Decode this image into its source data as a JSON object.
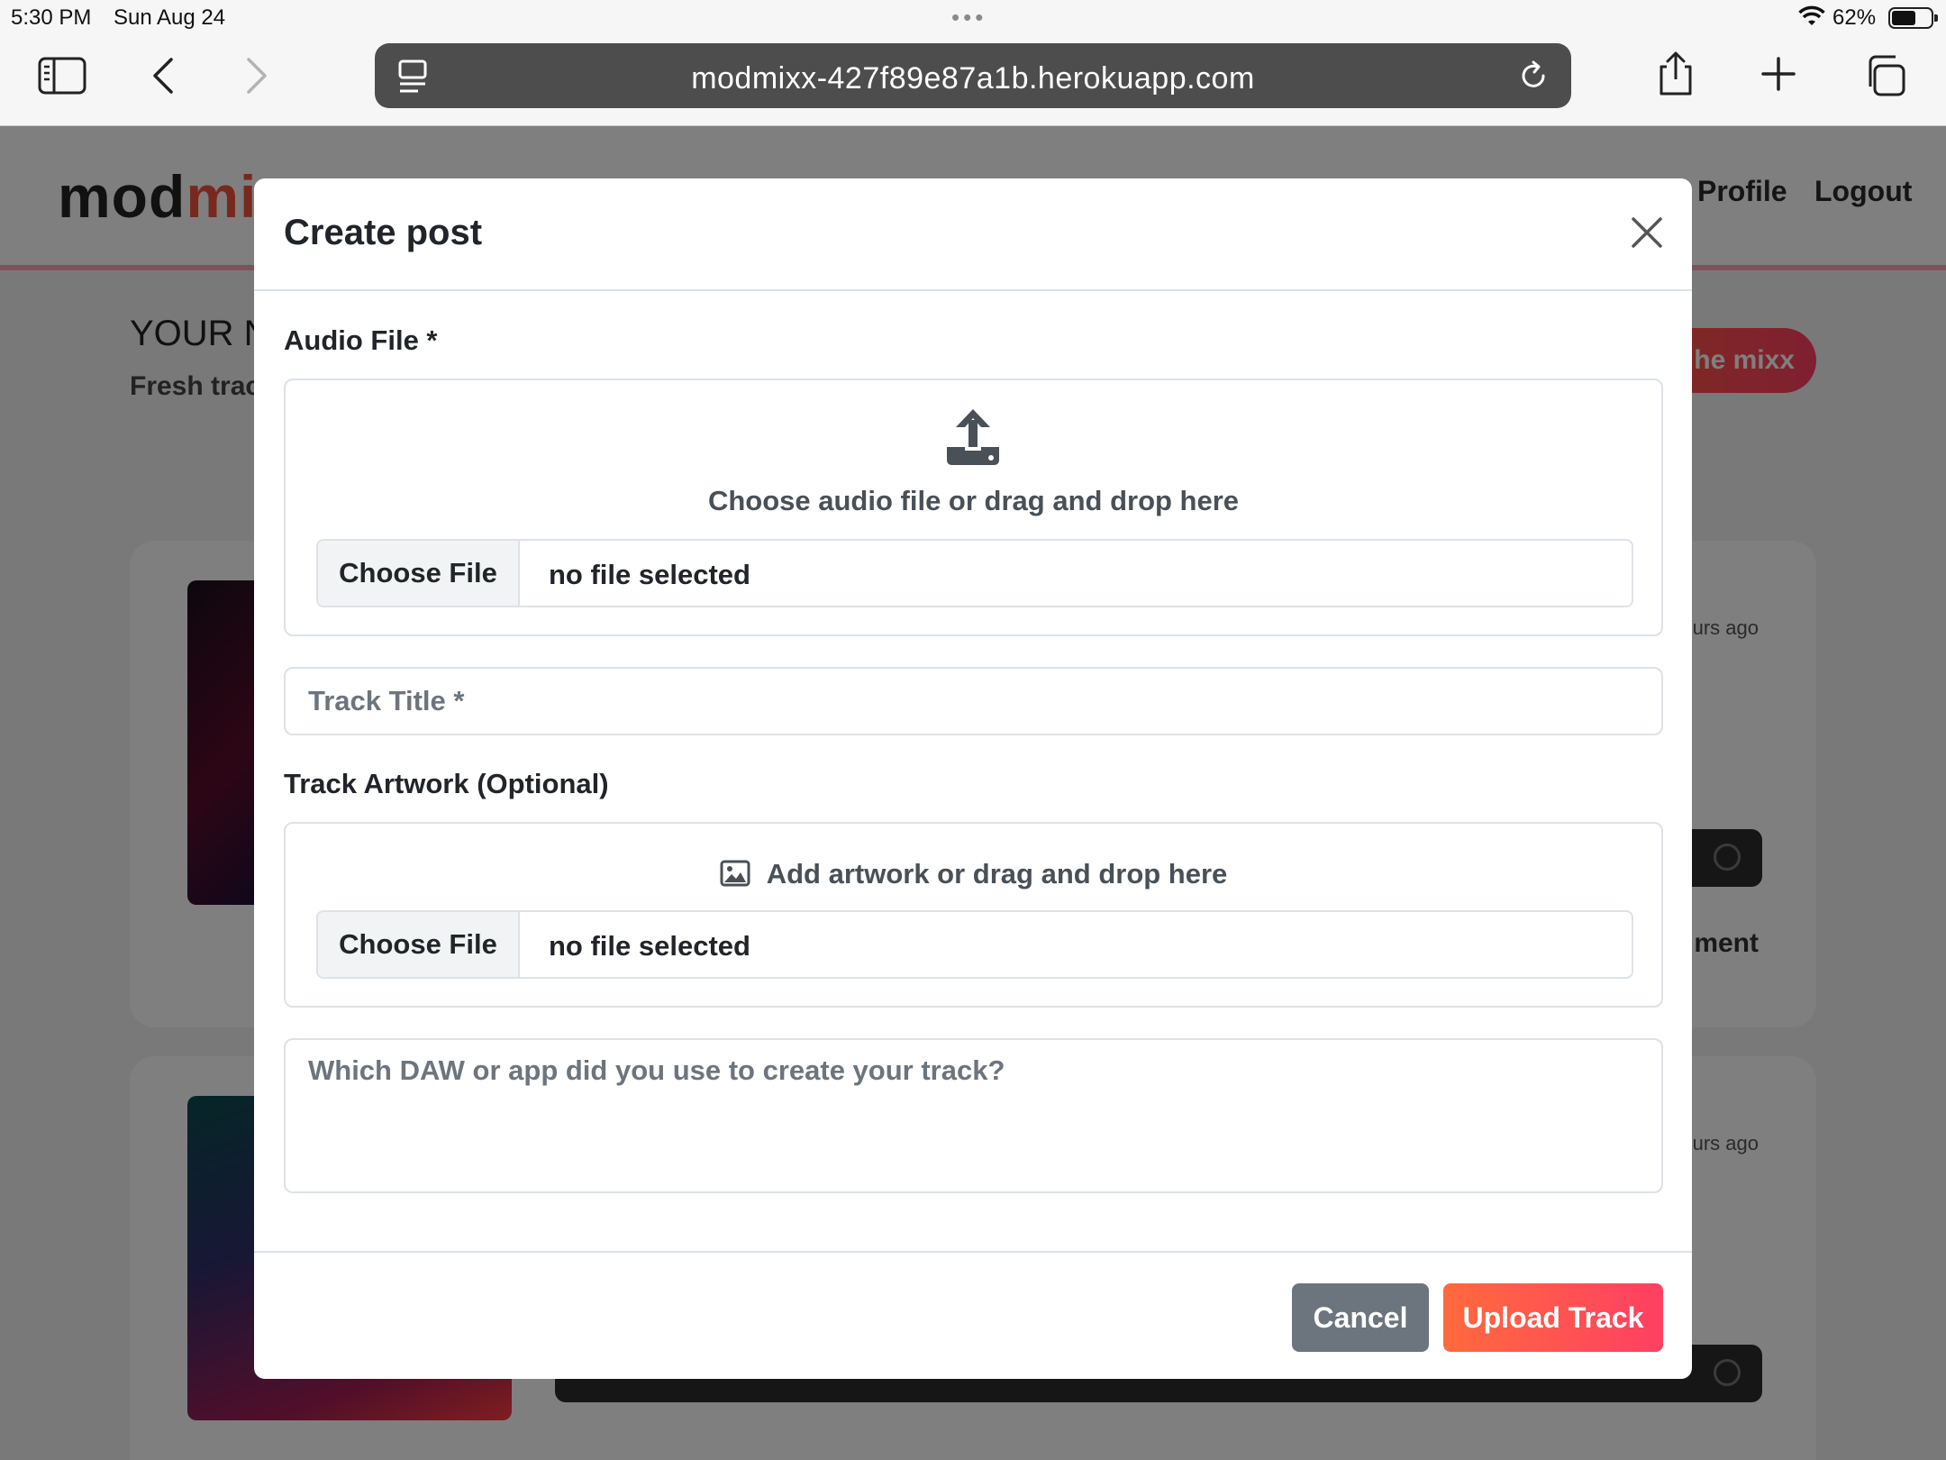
{
  "status_bar": {
    "time": "5:30 PM",
    "date": "Sun Aug 24",
    "battery_percent": "62%",
    "battery_level": 0.62
  },
  "browser": {
    "url": "modmixx-427f89e87a1b.herokuapp.com"
  },
  "background_page": {
    "logo": {
      "part1": "mod",
      "part2": "mix"
    },
    "nav": {
      "profile": "Profile",
      "logout": "Logout"
    },
    "heading": "YOUR N",
    "subheading": "Fresh trac",
    "cta_label": "he mixx",
    "cards": [
      {
        "time": "urs ago",
        "comment_text": "ment"
      },
      {
        "time": "urs ago",
        "comment_text": ""
      }
    ]
  },
  "modal": {
    "title": "Create post",
    "audio": {
      "label": "Audio File *",
      "dropzone_text": "Choose audio file or drag and drop here",
      "choose_button": "Choose File",
      "file_status": "no file selected"
    },
    "track_title": {
      "placeholder": "Track Title *",
      "value": ""
    },
    "artwork": {
      "label": "Track Artwork (Optional)",
      "dropzone_text": "Add artwork or drag and drop here",
      "choose_button": "Choose File",
      "file_status": "no file selected"
    },
    "daw": {
      "placeholder": "Which DAW or app did you use to create your track?",
      "value": ""
    },
    "buttons": {
      "cancel": "Cancel",
      "upload": "Upload Track"
    }
  },
  "colors": {
    "accent_gradient_start": "#ff6a3d",
    "accent_gradient_end": "#ff3f63",
    "cancel_button": "#6c757d",
    "modal_text": "#212529",
    "border": "#dee2e6"
  },
  "icons": [
    "sidebar-icon",
    "back-icon",
    "forward-icon",
    "reader-icon",
    "reload-icon",
    "share-icon",
    "new-tab-icon",
    "tabs-icon",
    "close-icon",
    "upload-icon",
    "image-icon",
    "wifi-icon",
    "battery-icon"
  ]
}
